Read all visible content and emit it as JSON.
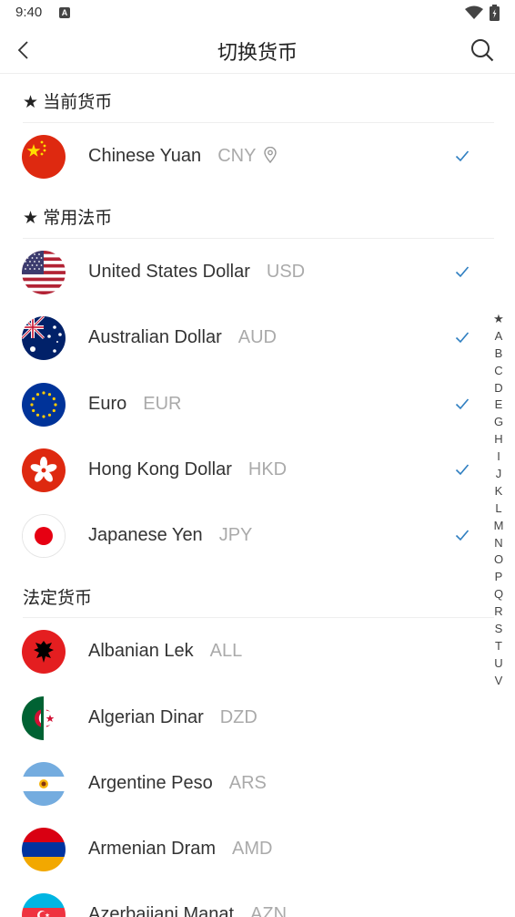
{
  "status_bar": {
    "time": "9:40"
  },
  "header": {
    "title": "切换货币"
  },
  "sections": {
    "current": {
      "title": "★ 当前货币"
    },
    "common": {
      "title": "★ 常用法币"
    },
    "fiat": {
      "title": "法定货币"
    }
  },
  "current_currency": {
    "name": "Chinese Yuan",
    "code": "CNY",
    "selected": true,
    "flag": "china-flag"
  },
  "common_currencies": [
    {
      "name": "United States Dollar",
      "code": "USD",
      "selected": true,
      "flag": "usa-flag"
    },
    {
      "name": "Australian Dollar",
      "code": "AUD",
      "selected": true,
      "flag": "australia-flag"
    },
    {
      "name": "Euro",
      "code": "EUR",
      "selected": true,
      "flag": "eu-flag"
    },
    {
      "name": "Hong Kong Dollar",
      "code": "HKD",
      "selected": true,
      "flag": "hong-kong-flag"
    },
    {
      "name": "Japanese Yen",
      "code": "JPY",
      "selected": true,
      "flag": "japan-flag"
    }
  ],
  "fiat_currencies": [
    {
      "name": "Albanian Lek",
      "code": "ALL",
      "flag": "albania-flag"
    },
    {
      "name": "Algerian Dinar",
      "code": "DZD",
      "flag": "algeria-flag"
    },
    {
      "name": "Argentine Peso",
      "code": "ARS",
      "flag": "argentina-flag"
    },
    {
      "name": "Armenian Dram",
      "code": "AMD",
      "flag": "armenia-flag"
    },
    {
      "name": "Azerbaijani Manat",
      "code": "AZN",
      "flag": "azerbaijan-flag"
    }
  ],
  "alphabet_index": [
    "★",
    "A",
    "B",
    "C",
    "D",
    "E",
    "G",
    "H",
    "I",
    "J",
    "K",
    "L",
    "M",
    "N",
    "O",
    "P",
    "Q",
    "R",
    "S",
    "T",
    "U",
    "V"
  ],
  "colors": {
    "accent": "#2f7fc1",
    "code_gray": "#aaaaaa",
    "divider": "#eeeeee"
  }
}
